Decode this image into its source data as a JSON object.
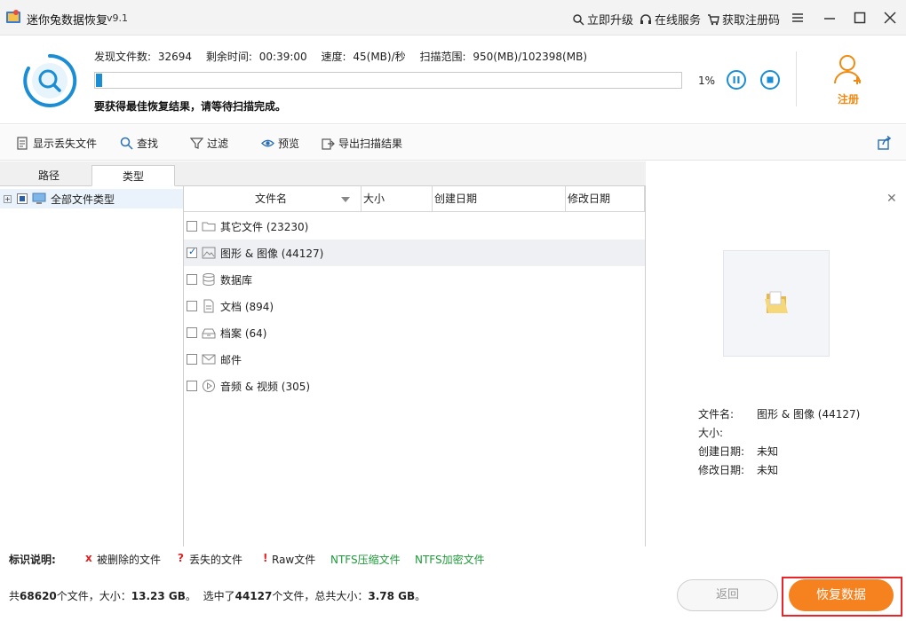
{
  "titlebar": {
    "title": "迷你兔数据恢复",
    "version": "v9.1",
    "links": [
      "立即升级",
      "在线服务",
      "获取注册码"
    ]
  },
  "scan": {
    "found_label": "发现文件数:",
    "found_value": "32694",
    "remaining_label": "剩余时间:",
    "remaining_value": "00:39:00",
    "speed_label": "速度:",
    "speed_value": "45(MB)/秒",
    "range_label": "扫描范围:",
    "range_value": "950(MB)/102398(MB)",
    "progress_fraction": 0.01,
    "percent": "1%",
    "hint": "要获得最佳恢复结果，请等待扫描完成。",
    "accent_color": "#1a8dd4"
  },
  "register": {
    "label": "注册",
    "color": "#f08a12"
  },
  "toolbar": {
    "show_lost": "显示丢失文件",
    "find": "查找",
    "filter": "过滤",
    "preview": "预览",
    "export": "导出扫描结果"
  },
  "tabs": [
    "路径",
    "类型"
  ],
  "tree": {
    "root_label": "全部文件类型"
  },
  "columns": [
    "文件名",
    "大小",
    "创建日期",
    "修改日期"
  ],
  "files": [
    {
      "label": "其它文件 (23230)",
      "icon": "folder-icon",
      "checked": false,
      "selected": false
    },
    {
      "label": "图形 & 图像 (44127)",
      "icon": "image-icon",
      "checked": true,
      "selected": true
    },
    {
      "label": "数据库",
      "icon": "database-icon",
      "checked": false,
      "selected": false
    },
    {
      "label": "文档 (894)",
      "icon": "document-icon",
      "checked": false,
      "selected": false
    },
    {
      "label": "档案 (64)",
      "icon": "archive-icon",
      "checked": false,
      "selected": false
    },
    {
      "label": "邮件",
      "icon": "mail-icon",
      "checked": false,
      "selected": false
    },
    {
      "label": "音频 & 视频 (305)",
      "icon": "media-icon",
      "checked": false,
      "selected": false
    }
  ],
  "preview": {
    "name_label": "文件名:",
    "name_value": "图形 & 图像 (44127)",
    "size_label": "大小:",
    "size_value": "",
    "created_label": "创建日期:",
    "created_value": "未知",
    "modified_label": "修改日期:",
    "modified_value": "未知"
  },
  "legend": {
    "title": "标识说明:",
    "deleted_mark": "x",
    "deleted": "被删除的文件",
    "lost_mark": "?",
    "lost": "丢失的文件",
    "raw_mark": "!",
    "raw": "Raw文件",
    "ntfs_compressed": "NTFS压缩文件",
    "ntfs_encrypted": "NTFS加密文件"
  },
  "footer": {
    "total_prefix": "共",
    "total_count": "68620",
    "total_mid": "个文件，大小：",
    "total_size": "13.23 GB",
    "total_suffix": "。",
    "sel_prefix": "选中了",
    "sel_count": "44127",
    "sel_mid": "个文件，总共大小：",
    "sel_size": "3.78 GB",
    "sel_suffix": "。",
    "back": "返回",
    "recover": "恢复数据"
  }
}
